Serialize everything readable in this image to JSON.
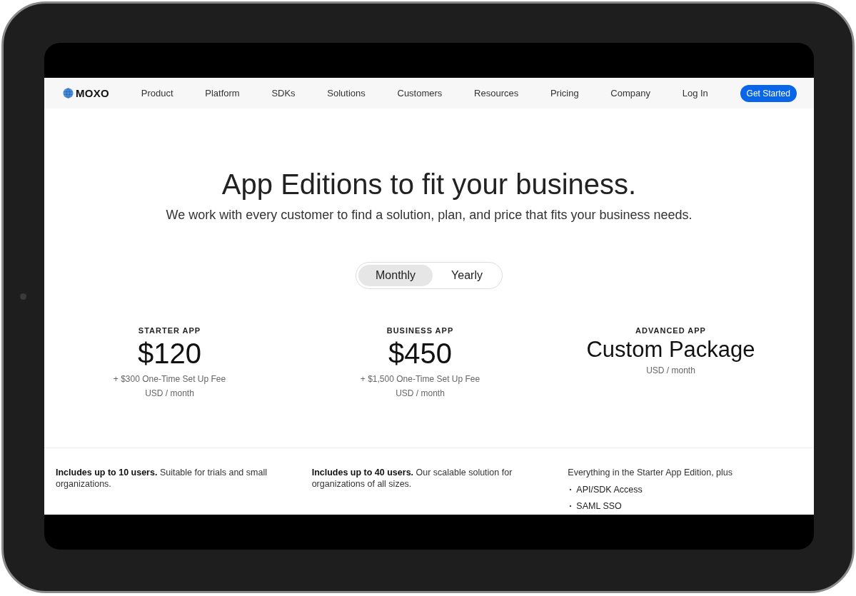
{
  "nav": {
    "logo": "MOXO",
    "links": [
      "Product",
      "Platform",
      "SDKs",
      "Solutions",
      "Customers",
      "Resources",
      "Pricing",
      "Company",
      "Log In"
    ],
    "cta": "Get Started"
  },
  "hero": {
    "title": "App Editions to fit your business.",
    "subtitle": "We work with every customer to find a solution, plan, and price that fits your business needs."
  },
  "billing_toggle": [
    {
      "label": "Monthly",
      "selected": true
    },
    {
      "label": "Yearly",
      "selected": false
    }
  ],
  "plans": [
    {
      "name": "STARTER APP",
      "price": "$120",
      "kind": "price",
      "setup_fee": "+ $300 One-Time Set Up Fee",
      "unit": "USD / month"
    },
    {
      "name": "BUSINESS APP",
      "price": "$450",
      "kind": "price",
      "setup_fee": "+ $1,500 One-Time Set Up Fee",
      "unit": "USD / month"
    },
    {
      "name": "ADVANCED APP",
      "price": "Custom Package",
      "kind": "custom",
      "unit": "USD / month"
    }
  ],
  "details": [
    {
      "text": "**Includes up to 10 users.** Suitable for trials and small organizations."
    },
    {
      "text": "**Includes up to 40 users.** Our scalable solution for organizations of all sizes."
    },
    {
      "text": "Everything in the Starter App Edition, plus",
      "bullets": [
        "API/SDK Access",
        "SAML SSO"
      ]
    }
  ]
}
